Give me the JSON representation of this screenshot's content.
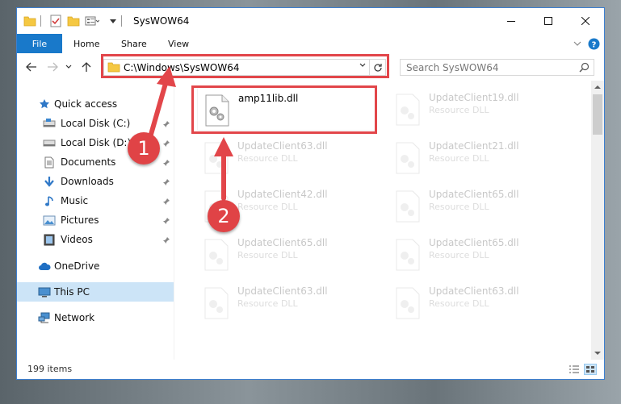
{
  "window": {
    "title": "SysWOW64",
    "controls": {
      "minimize": "—",
      "maximize": "☐",
      "close": "✕"
    }
  },
  "ribbon": {
    "tabs": [
      {
        "label": "File"
      },
      {
        "label": "Home"
      },
      {
        "label": "Share"
      },
      {
        "label": "View"
      }
    ],
    "collapse_glyph": "⌄",
    "help_glyph": "?"
  },
  "nav": {
    "back": "←",
    "forward": "→",
    "recent": "⌄",
    "up": "↑",
    "address": "C:\\Windows\\SysWOW64",
    "address_dropdown": "⌄",
    "refresh": "↻",
    "search_placeholder": "Search SysWOW64"
  },
  "sidebar": {
    "items": [
      {
        "label": "Quick access",
        "icon": "star-icon",
        "pinned": false
      },
      {
        "label": "Local Disk (C:)",
        "icon": "drive-icon",
        "pinned": true
      },
      {
        "label": "Local Disk (D:)",
        "icon": "drive-icon",
        "pinned": true
      },
      {
        "label": "Documents",
        "icon": "documents-icon",
        "pinned": true
      },
      {
        "label": "Downloads",
        "icon": "download-icon",
        "pinned": true
      },
      {
        "label": "Music",
        "icon": "music-icon",
        "pinned": true
      },
      {
        "label": "Pictures",
        "icon": "pictures-icon",
        "pinned": true
      },
      {
        "label": "Videos",
        "icon": "videos-icon",
        "pinned": true
      },
      {
        "label": "OneDrive",
        "icon": "cloud-icon",
        "pinned": false
      },
      {
        "label": "This PC",
        "icon": "computer-icon",
        "pinned": false,
        "selected": true
      },
      {
        "label": "Network",
        "icon": "network-icon",
        "pinned": false
      }
    ]
  },
  "files": [
    {
      "name": "amp11lib.dll",
      "type": "",
      "highlighted": true
    },
    {
      "name": "UpdateClient19.dll",
      "type": "Resource DLL"
    },
    {
      "name": "UpdateClient63.dll",
      "type": "Resource DLL"
    },
    {
      "name": "UpdateClient21.dll",
      "type": "Resource DLL"
    },
    {
      "name": "UpdateClient42.dll",
      "type": "Resource DLL"
    },
    {
      "name": "UpdateClient65.dll",
      "type": "Resource DLL"
    },
    {
      "name": "UpdateClient65.dll",
      "type": "Resource DLL"
    },
    {
      "name": "UpdateClient65.dll",
      "type": "Resource DLL"
    },
    {
      "name": "UpdateClient63.dll",
      "type": "Resource DLL"
    },
    {
      "name": "UpdateClient63.dll",
      "type": "Resource DLL"
    }
  ],
  "status": {
    "item_count": "199 items"
  },
  "annotations": {
    "step1": "1",
    "step2": "2",
    "color": "#e2464a"
  },
  "colors": {
    "accent": "#1979ca",
    "selection": "#cce4f7"
  }
}
